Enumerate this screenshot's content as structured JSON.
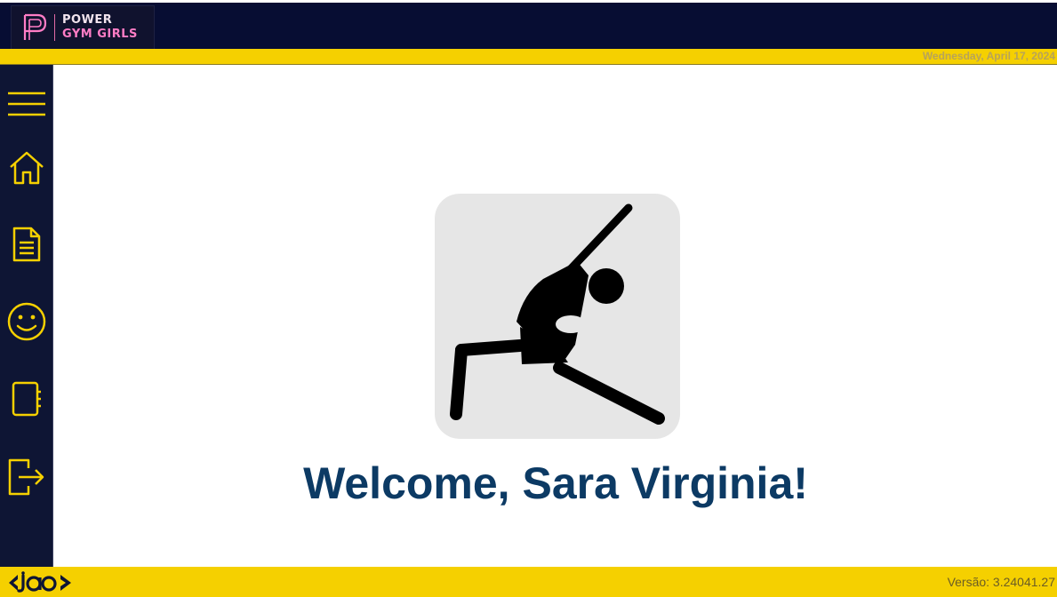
{
  "app": {
    "brand_line1": "POWER",
    "brand_line2": "GYM GIRLS",
    "brand_colors": {
      "navy": "#070d33",
      "yellow": "#f5d000",
      "pink": "#ff7dc6",
      "heading": "#0c3a64"
    }
  },
  "header": {
    "date": "Wednesday, April 17, 2024"
  },
  "sidebar": {
    "items": [
      {
        "name": "menu",
        "icon": "hamburger-menu-icon"
      },
      {
        "name": "home",
        "icon": "home-icon"
      },
      {
        "name": "documents",
        "icon": "document-icon"
      },
      {
        "name": "profile",
        "icon": "smiley-face-icon"
      },
      {
        "name": "notebook",
        "icon": "notebook-icon"
      },
      {
        "name": "logout",
        "icon": "logout-icon"
      }
    ]
  },
  "main": {
    "hero_icon": "yoga-stretch-icon",
    "welcome": "Welcome, Sara Virginia!"
  },
  "footer": {
    "logo_icon": "ja-logo-icon",
    "version": "Versão: 3.24041.27"
  }
}
